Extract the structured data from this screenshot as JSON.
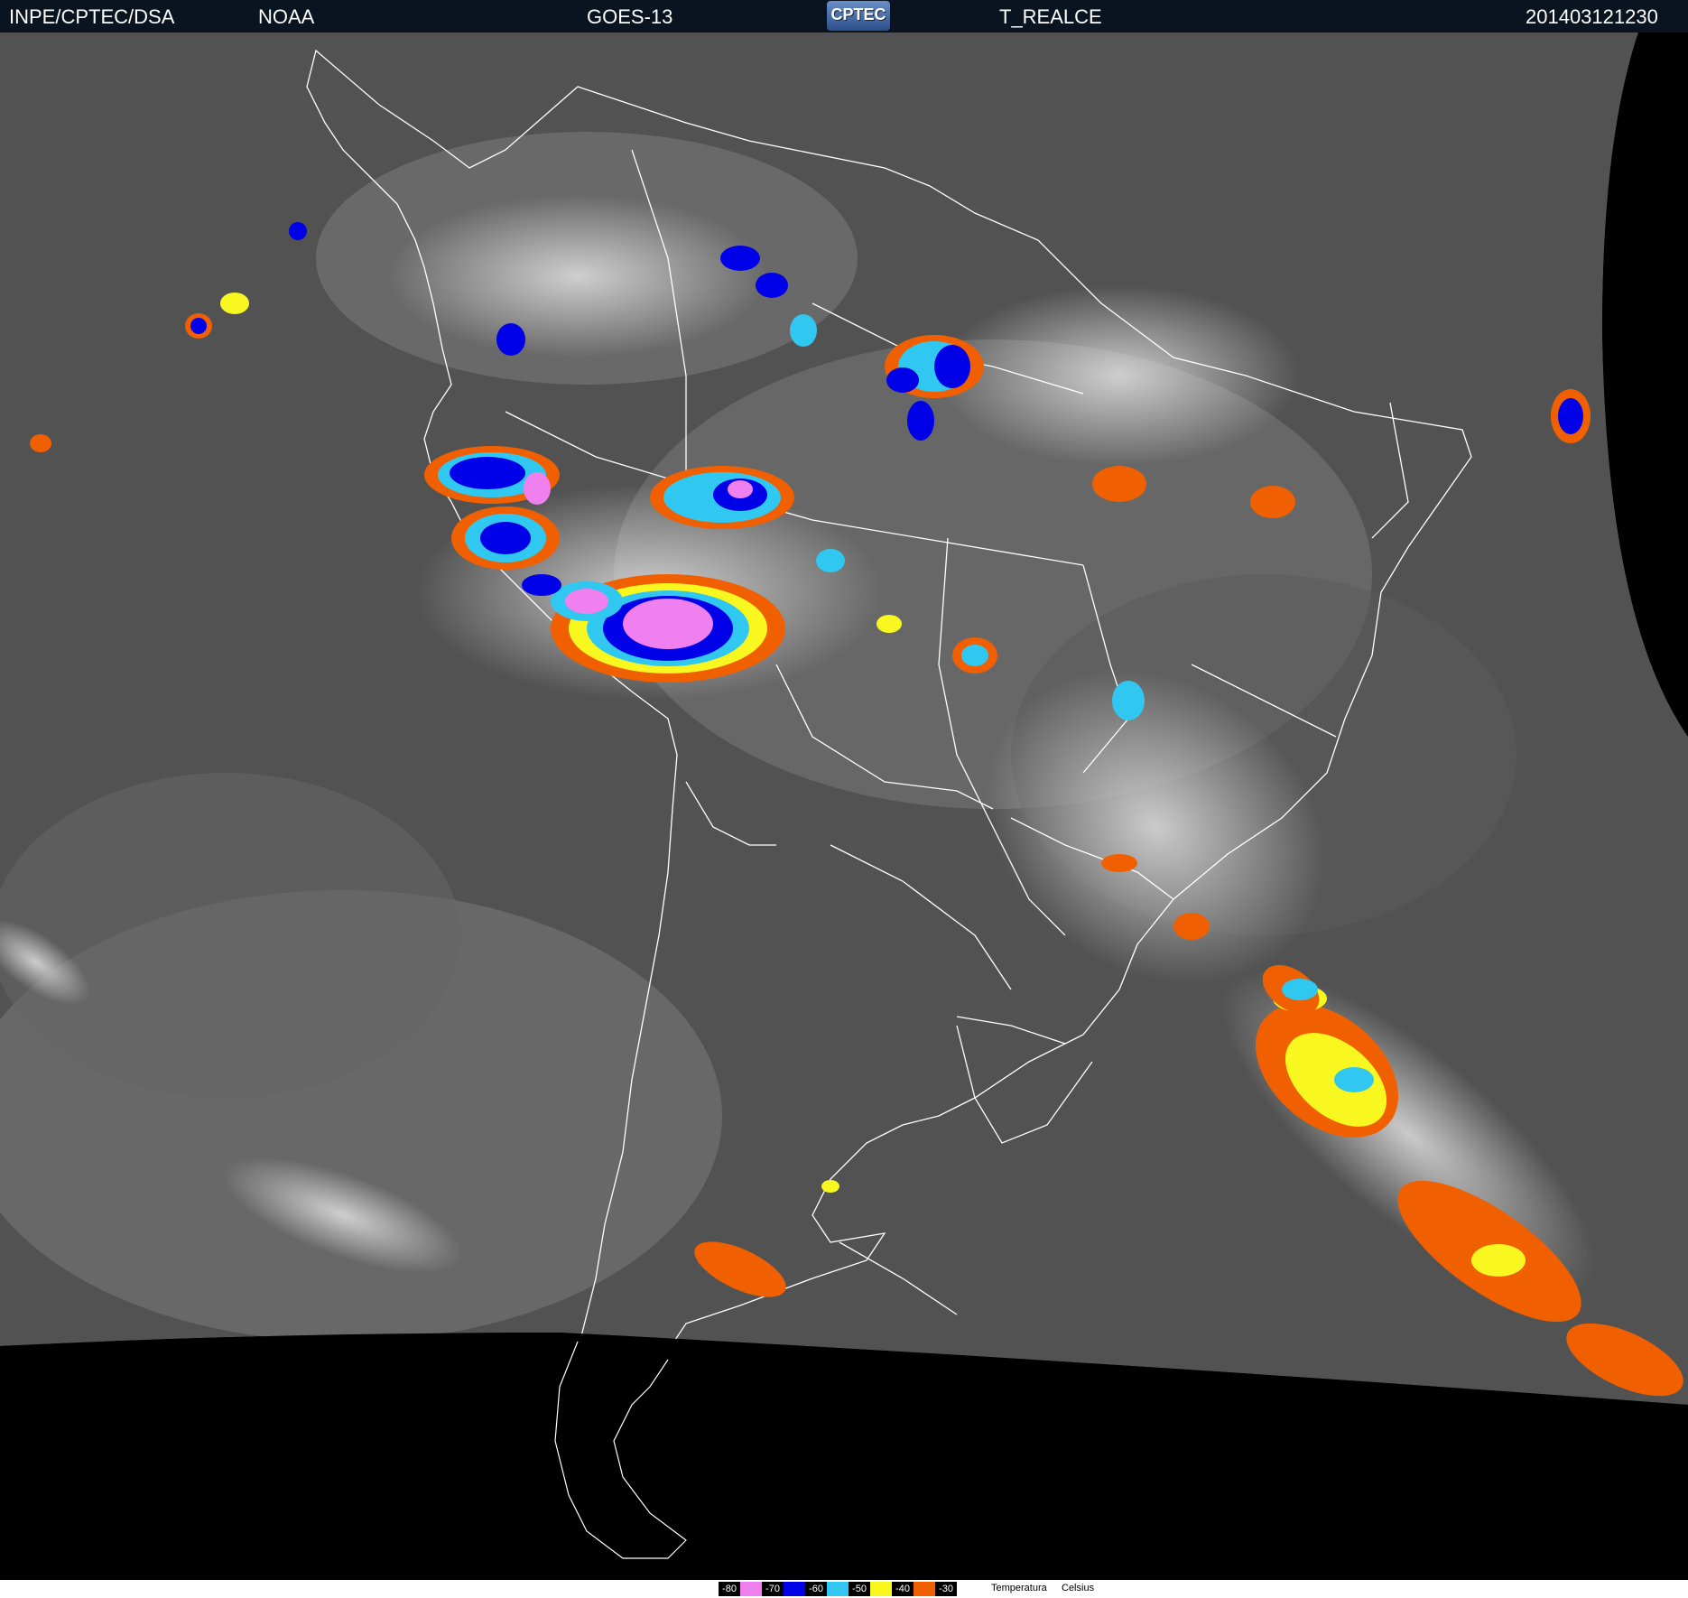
{
  "header": {
    "org": "INPE/CPTEC/DSA",
    "agency": "NOAA",
    "satellite": "GOES-13",
    "logo_text": "CPTEC",
    "product": "T_REALCE",
    "timestamp": "201403121230"
  },
  "legend": {
    "title": "Temperatura",
    "unit": "Celsius",
    "items": [
      {
        "label": "-80",
        "color": "#f080f0"
      },
      {
        "label": "-70",
        "color": "#0000e8"
      },
      {
        "label": "-60",
        "color": "#30c8f0"
      },
      {
        "label": "-50",
        "color": "#f8f820"
      },
      {
        "label": "-40",
        "color": "#f06000"
      },
      {
        "label": "-30",
        "color": ""
      }
    ]
  }
}
